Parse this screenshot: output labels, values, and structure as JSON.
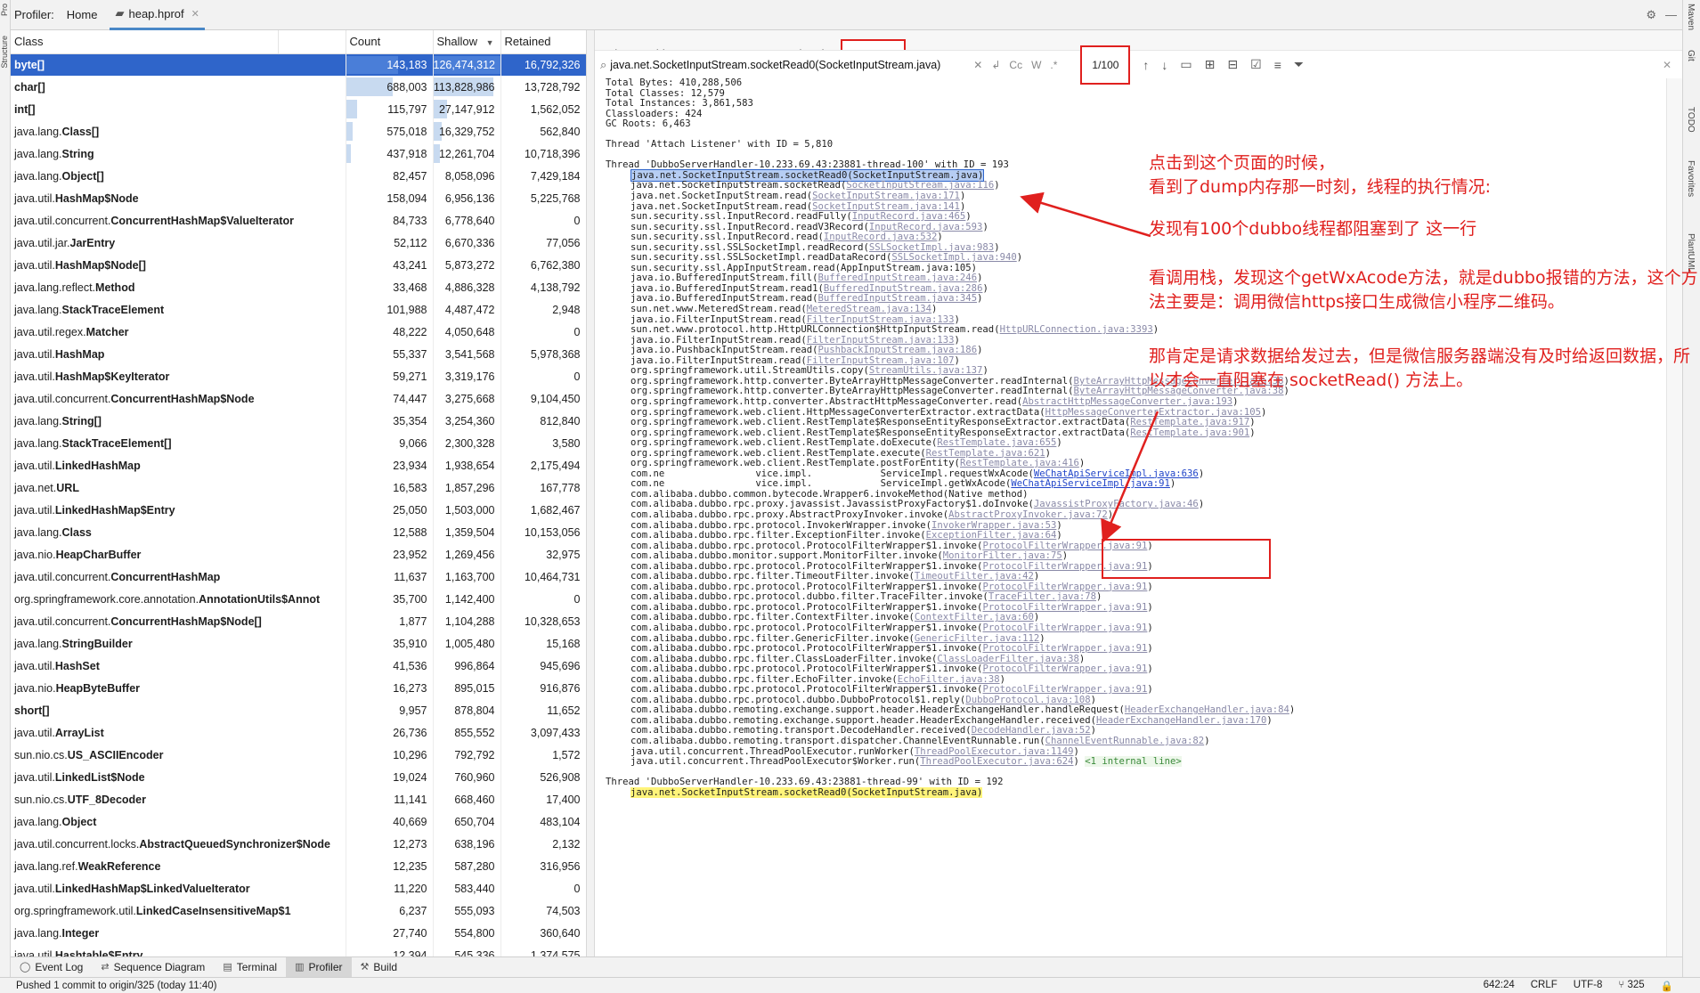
{
  "title_bar": {
    "crumbs": [
      "Profiler:",
      "Home"
    ],
    "file_tab": "heap.hprof"
  },
  "class_table": {
    "columns": [
      "Class",
      "Count",
      "Shallow",
      "Retained"
    ],
    "sort_indicator": "▼",
    "selected_row": 0,
    "rows": [
      {
        "pkg": "",
        "cls": "byte[]",
        "count": "143,183",
        "shallow": "126,474,312",
        "retained": "16,792,326",
        "bar": 1.0
      },
      {
        "pkg": "",
        "cls": "char[]",
        "count": "688,003",
        "shallow": "113,828,986",
        "retained": "13,728,792",
        "bar": 0.9
      },
      {
        "pkg": "",
        "cls": "int[]",
        "count": "115,797",
        "shallow": "27,147,912",
        "retained": "1,562,052",
        "bar": 0.21
      },
      {
        "pkg": "java.lang.",
        "cls": "Class[]",
        "count": "575,018",
        "shallow": "16,329,752",
        "retained": "562,840",
        "bar": 0.13
      },
      {
        "pkg": "java.lang.",
        "cls": "String",
        "count": "437,918",
        "shallow": "12,261,704",
        "retained": "10,718,396",
        "bar": 0.1
      },
      {
        "pkg": "java.lang.",
        "cls": "Object[]",
        "count": "82,457",
        "shallow": "8,058,096",
        "retained": "7,429,184",
        "bar": 0.0
      },
      {
        "pkg": "java.util.",
        "cls": "HashMap$Node",
        "count": "158,094",
        "shallow": "6,956,136",
        "retained": "5,225,768",
        "bar": 0.0
      },
      {
        "pkg": "java.util.concurrent.",
        "cls": "ConcurrentHashMap$ValueIterator",
        "count": "84,733",
        "shallow": "6,778,640",
        "retained": "0",
        "bar": 0.0
      },
      {
        "pkg": "java.util.jar.",
        "cls": "JarEntry",
        "count": "52,112",
        "shallow": "6,670,336",
        "retained": "77,056",
        "bar": 0.0
      },
      {
        "pkg": "java.util.",
        "cls": "HashMap$Node[]",
        "count": "43,241",
        "shallow": "5,873,272",
        "retained": "6,762,380",
        "bar": 0.0
      },
      {
        "pkg": "java.lang.reflect.",
        "cls": "Method",
        "count": "33,468",
        "shallow": "4,886,328",
        "retained": "4,138,792",
        "bar": 0.0
      },
      {
        "pkg": "java.lang.",
        "cls": "StackTraceElement",
        "count": "101,988",
        "shallow": "4,487,472",
        "retained": "2,948",
        "bar": 0.0
      },
      {
        "pkg": "java.util.regex.",
        "cls": "Matcher",
        "count": "48,222",
        "shallow": "4,050,648",
        "retained": "0",
        "bar": 0.0
      },
      {
        "pkg": "java.util.",
        "cls": "HashMap",
        "count": "55,337",
        "shallow": "3,541,568",
        "retained": "5,978,368",
        "bar": 0.0
      },
      {
        "pkg": "java.util.",
        "cls": "HashMap$KeyIterator",
        "count": "59,271",
        "shallow": "3,319,176",
        "retained": "0",
        "bar": 0.0
      },
      {
        "pkg": "java.util.concurrent.",
        "cls": "ConcurrentHashMap$Node",
        "count": "74,447",
        "shallow": "3,275,668",
        "retained": "9,104,450",
        "bar": 0.0
      },
      {
        "pkg": "java.lang.",
        "cls": "String[]",
        "count": "35,354",
        "shallow": "3,254,360",
        "retained": "812,840",
        "bar": 0.0
      },
      {
        "pkg": "java.lang.",
        "cls": "StackTraceElement[]",
        "count": "9,066",
        "shallow": "2,300,328",
        "retained": "3,580",
        "bar": 0.0
      },
      {
        "pkg": "java.util.",
        "cls": "LinkedHashMap",
        "count": "23,934",
        "shallow": "1,938,654",
        "retained": "2,175,494",
        "bar": 0.0
      },
      {
        "pkg": "java.net.",
        "cls": "URL",
        "count": "16,583",
        "shallow": "1,857,296",
        "retained": "167,778",
        "bar": 0.0
      },
      {
        "pkg": "java.util.",
        "cls": "LinkedHashMap$Entry",
        "count": "25,050",
        "shallow": "1,503,000",
        "retained": "1,682,467",
        "bar": 0.0
      },
      {
        "pkg": "java.lang.",
        "cls": "Class",
        "count": "12,588",
        "shallow": "1,359,504",
        "retained": "10,153,056",
        "bar": 0.0
      },
      {
        "pkg": "java.nio.",
        "cls": "HeapCharBuffer",
        "count": "23,952",
        "shallow": "1,269,456",
        "retained": "32,975",
        "bar": 0.0
      },
      {
        "pkg": "java.util.concurrent.",
        "cls": "ConcurrentHashMap",
        "count": "11,637",
        "shallow": "1,163,700",
        "retained": "10,464,731",
        "bar": 0.0
      },
      {
        "pkg": "org.springframework.core.annotation.",
        "cls": "AnnotationUtils$Annot",
        "count": "35,700",
        "shallow": "1,142,400",
        "retained": "0",
        "bar": 0.0
      },
      {
        "pkg": "java.util.concurrent.",
        "cls": "ConcurrentHashMap$Node[]",
        "count": "1,877",
        "shallow": "1,104,288",
        "retained": "10,328,653",
        "bar": 0.0
      },
      {
        "pkg": "java.lang.",
        "cls": "StringBuilder",
        "count": "35,910",
        "shallow": "1,005,480",
        "retained": "15,168",
        "bar": 0.0
      },
      {
        "pkg": "java.util.",
        "cls": "HashSet",
        "count": "41,536",
        "shallow": "996,864",
        "retained": "945,696",
        "bar": 0.0
      },
      {
        "pkg": "java.nio.",
        "cls": "HeapByteBuffer",
        "count": "16,273",
        "shallow": "895,015",
        "retained": "916,876",
        "bar": 0.0
      },
      {
        "pkg": "",
        "cls": "short[]",
        "count": "9,957",
        "shallow": "878,804",
        "retained": "11,652",
        "bar": 0.0
      },
      {
        "pkg": "java.util.",
        "cls": "ArrayList",
        "count": "26,736",
        "shallow": "855,552",
        "retained": "3,097,433",
        "bar": 0.0
      },
      {
        "pkg": "sun.nio.cs.",
        "cls": "US_ASCIIEncoder",
        "count": "10,296",
        "shallow": "792,792",
        "retained": "1,572",
        "bar": 0.0
      },
      {
        "pkg": "java.util.",
        "cls": "LinkedList$Node",
        "count": "19,024",
        "shallow": "760,960",
        "retained": "526,908",
        "bar": 0.0
      },
      {
        "pkg": "sun.nio.cs.",
        "cls": "UTF_8Decoder",
        "count": "11,141",
        "shallow": "668,460",
        "retained": "17,400",
        "bar": 0.0
      },
      {
        "pkg": "java.lang.",
        "cls": "Object",
        "count": "40,669",
        "shallow": "650,704",
        "retained": "483,104",
        "bar": 0.0
      },
      {
        "pkg": "java.util.concurrent.locks.",
        "cls": "AbstractQueuedSynchronizer$Node",
        "count": "12,273",
        "shallow": "638,196",
        "retained": "2,132",
        "bar": 0.0
      },
      {
        "pkg": "java.lang.ref.",
        "cls": "WeakReference",
        "count": "12,235",
        "shallow": "587,280",
        "retained": "316,956",
        "bar": 0.0
      },
      {
        "pkg": "java.util.",
        "cls": "LinkedHashMap$LinkedValueIterator",
        "count": "11,220",
        "shallow": "583,440",
        "retained": "0",
        "bar": 0.0
      },
      {
        "pkg": "org.springframework.util.",
        "cls": "LinkedCaseInsensitiveMap$1",
        "count": "6,237",
        "shallow": "555,093",
        "retained": "74,503",
        "bar": 0.0
      },
      {
        "pkg": "java.lang.",
        "cls": "Integer",
        "count": "27,740",
        "shallow": "554,800",
        "retained": "360,640",
        "bar": 0.0
      },
      {
        "pkg": "java.util.",
        "cls": "Hashtable$Entry",
        "count": "12,394",
        "shallow": "545,336",
        "retained": "1,374,575",
        "bar": 0.0
      }
    ]
  },
  "detail_tabs": {
    "items": [
      "Biggest Objects",
      "GC Roots",
      "Merged Paths",
      "Summary"
    ],
    "active": 3
  },
  "search": {
    "value": "java.net.SocketInputStream.socketRead0(SocketInputStream.java)",
    "opt_cc": "Cc",
    "opt_w": "W",
    "opt_regex": ".*",
    "match_count": "1/100"
  },
  "summary": {
    "header_lines": [
      "Total Bytes: 410,288,506",
      "Total Classes: 12,579",
      "Total Instances: 3,861,583",
      "Classloaders: 424",
      "GC Roots: 6,463",
      "",
      "Thread 'Attach Listener' with ID = 5,810",
      "",
      "Thread 'DubboServerHandler-10.233.69.43:23881-thread-100' with ID = 193"
    ],
    "stack": [
      {
        "text": "java.net.SocketInputStream.socketRead0(SocketInputStream.java)",
        "link": "",
        "style": "hlsel"
      },
      {
        "text": "java.net.SocketInputStream.socketRead(",
        "link": "SocketInputStream.java:116",
        "style": ""
      },
      {
        "text": "java.net.SocketInputStream.read(",
        "link": "SocketInputStream.java:171",
        "style": ""
      },
      {
        "text": "java.net.SocketInputStream.read(",
        "link": "SocketInputStream.java:141",
        "style": ""
      },
      {
        "text": "sun.security.ssl.InputRecord.readFully(",
        "link": "InputRecord.java:465",
        "style": ""
      },
      {
        "text": "sun.security.ssl.InputRecord.readV3Record(",
        "link": "InputRecord.java:593",
        "style": ""
      },
      {
        "text": "sun.security.ssl.InputRecord.read(",
        "link": "InputRecord.java:532",
        "style": ""
      },
      {
        "text": "sun.security.ssl.SSLSocketImpl.readRecord(",
        "link": "SSLSocketImpl.java:983",
        "style": ""
      },
      {
        "text": "sun.security.ssl.SSLSocketImpl.readDataRecord(",
        "link": "SSLSocketImpl.java:940",
        "style": ""
      },
      {
        "text": "sun.security.ssl.AppInputStream.read(AppInputStream.java:105)",
        "link": "",
        "style": ""
      },
      {
        "text": "java.io.BufferedInputStream.fill(",
        "link": "BufferedInputStream.java:246",
        "style": ""
      },
      {
        "text": "java.io.BufferedInputStream.read1(",
        "link": "BufferedInputStream.java:286",
        "style": ""
      },
      {
        "text": "java.io.BufferedInputStream.read(",
        "link": "BufferedInputStream.java:345",
        "style": ""
      },
      {
        "text": "sun.net.www.MeteredStream.read(",
        "link": "MeteredStream.java:134",
        "style": ""
      },
      {
        "text": "java.io.FilterInputStream.read(",
        "link": "FilterInputStream.java:133",
        "style": ""
      },
      {
        "text": "sun.net.www.protocol.http.HttpURLConnection$HttpInputStream.read(",
        "link": "HttpURLConnection.java:3393",
        "style": ""
      },
      {
        "text": "java.io.FilterInputStream.read(",
        "link": "FilterInputStream.java:133",
        "style": ""
      },
      {
        "text": "java.io.PushbackInputStream.read(",
        "link": "PushbackInputStream.java:186",
        "style": ""
      },
      {
        "text": "java.io.FilterInputStream.read(",
        "link": "FilterInputStream.java:107",
        "style": ""
      },
      {
        "text": "org.springframework.util.StreamUtils.copy(",
        "link": "StreamUtils.java:137",
        "style": ""
      },
      {
        "text": "org.springframework.http.converter.ByteArrayHttpMessageConverter.readInternal(",
        "link": "ByteArrayHttpMessageConverter.java:38",
        "style": ""
      },
      {
        "text": "org.springframework.http.converter.ByteArrayHttpMessageConverter.readInternal(",
        "link": "ByteArrayHttpMessageConverter.java:38",
        "style": ""
      },
      {
        "text": "org.springframework.http.converter.AbstractHttpMessageConverter.read(",
        "link": "AbstractHttpMessageConverter.java:193",
        "style": ""
      },
      {
        "text": "org.springframework.web.client.HttpMessageConverterExtractor.extractData(",
        "link": "HttpMessageConverterExtractor.java:105",
        "style": ""
      },
      {
        "text": "org.springframework.web.client.RestTemplate$ResponseEntityResponseExtractor.extractData(",
        "link": "RestTemplate.java:917",
        "style": ""
      },
      {
        "text": "org.springframework.web.client.RestTemplate$ResponseEntityResponseExtractor.extractData(",
        "link": "RestTemplate.java:901",
        "style": ""
      },
      {
        "text": "org.springframework.web.client.RestTemplate.doExecute(",
        "link": "RestTemplate.java:655",
        "style": ""
      },
      {
        "text": "org.springframework.web.client.RestTemplate.execute(",
        "link": "RestTemplate.java:621",
        "style": ""
      },
      {
        "text": "org.springframework.web.client.RestTemplate.postForEntity(",
        "link": "RestTemplate.java:416",
        "style": ""
      },
      {
        "text": "com.ne                vice.impl.            ServiceImpl.requestWxAcode(",
        "link": "WeChatApiServiceImpl.java:636",
        "style": "blue"
      },
      {
        "text": "com.ne                vice.impl.            ServiceImpl.getWxAcode(",
        "link": "WeChatApiServiceImpl.java:91",
        "style": "blue"
      },
      {
        "text": "com.alibaba.dubbo.common.bytecode.Wrapper6.invokeMethod(Native method)",
        "link": "",
        "style": ""
      },
      {
        "text": "com.alibaba.dubbo.rpc.proxy.javassist.JavassistProxyFactory$1.doInvoke(",
        "link": "JavassistProxyFactory.java:46",
        "style": ""
      },
      {
        "text": "com.alibaba.dubbo.rpc.proxy.AbstractProxyInvoker.invoke(",
        "link": "AbstractProxyInvoker.java:72",
        "style": ""
      },
      {
        "text": "com.alibaba.dubbo.rpc.protocol.InvokerWrapper.invoke(",
        "link": "InvokerWrapper.java:53",
        "style": ""
      },
      {
        "text": "com.alibaba.dubbo.rpc.filter.ExceptionFilter.invoke(",
        "link": "ExceptionFilter.java:64",
        "style": ""
      },
      {
        "text": "com.alibaba.dubbo.rpc.protocol.ProtocolFilterWrapper$1.invoke(",
        "link": "ProtocolFilterWrapper.java:91",
        "style": ""
      },
      {
        "text": "com.alibaba.dubbo.monitor.support.MonitorFilter.invoke(",
        "link": "MonitorFilter.java:75",
        "style": ""
      },
      {
        "text": "com.alibaba.dubbo.rpc.protocol.ProtocolFilterWrapper$1.invoke(",
        "link": "ProtocolFilterWrapper.java:91",
        "style": ""
      },
      {
        "text": "com.alibaba.dubbo.rpc.filter.TimeoutFilter.invoke(",
        "link": "TimeoutFilter.java:42",
        "style": ""
      },
      {
        "text": "com.alibaba.dubbo.rpc.protocol.ProtocolFilterWrapper$1.invoke(",
        "link": "ProtocolFilterWrapper.java:91",
        "style": ""
      },
      {
        "text": "com.alibaba.dubbo.rpc.protocol.dubbo.filter.TraceFilter.invoke(",
        "link": "TraceFilter.java:78",
        "style": ""
      },
      {
        "text": "com.alibaba.dubbo.rpc.protocol.ProtocolFilterWrapper$1.invoke(",
        "link": "ProtocolFilterWrapper.java:91",
        "style": ""
      },
      {
        "text": "com.alibaba.dubbo.rpc.filter.ContextFilter.invoke(",
        "link": "ContextFilter.java:60",
        "style": ""
      },
      {
        "text": "com.alibaba.dubbo.rpc.protocol.ProtocolFilterWrapper$1.invoke(",
        "link": "ProtocolFilterWrapper.java:91",
        "style": ""
      },
      {
        "text": "com.alibaba.dubbo.rpc.filter.GenericFilter.invoke(",
        "link": "GenericFilter.java:112",
        "style": ""
      },
      {
        "text": "com.alibaba.dubbo.rpc.protocol.ProtocolFilterWrapper$1.invoke(",
        "link": "ProtocolFilterWrapper.java:91",
        "style": ""
      },
      {
        "text": "com.alibaba.dubbo.rpc.filter.ClassLoaderFilter.invoke(",
        "link": "ClassLoaderFilter.java:38",
        "style": ""
      },
      {
        "text": "com.alibaba.dubbo.rpc.protocol.ProtocolFilterWrapper$1.invoke(",
        "link": "ProtocolFilterWrapper.java:91",
        "style": ""
      },
      {
        "text": "com.alibaba.dubbo.rpc.filter.EchoFilter.invoke(",
        "link": "EchoFilter.java:38",
        "style": ""
      },
      {
        "text": "com.alibaba.dubbo.rpc.protocol.ProtocolFilterWrapper$1.invoke(",
        "link": "ProtocolFilterWrapper.java:91",
        "style": ""
      },
      {
        "text": "com.alibaba.dubbo.rpc.protocol.dubbo.DubboProtocol$1.reply(",
        "link": "DubboProtocol.java:108",
        "style": ""
      },
      {
        "text": "com.alibaba.dubbo.remoting.exchange.support.header.HeaderExchangeHandler.handleRequest(",
        "link": "HeaderExchangeHandler.java:84",
        "style": ""
      },
      {
        "text": "com.alibaba.dubbo.remoting.exchange.support.header.HeaderExchangeHandler.received(",
        "link": "HeaderExchangeHandler.java:170",
        "style": ""
      },
      {
        "text": "com.alibaba.dubbo.remoting.transport.DecodeHandler.received(",
        "link": "DecodeHandler.java:52",
        "style": ""
      },
      {
        "text": "com.alibaba.dubbo.remoting.transport.dispatcher.ChannelEventRunnable.run(",
        "link": "ChannelEventRunnable.java:82",
        "style": ""
      },
      {
        "text": "java.util.concurrent.ThreadPoolExecutor.runWorker(",
        "link": "ThreadPoolExecutor.java:1149",
        "style": ""
      },
      {
        "text": "java.util.concurrent.ThreadPoolExecutor$Worker.run(",
        "link": "ThreadPoolExecutor.java:624",
        "style": "internal"
      }
    ],
    "internal_line": "<1 internal line>",
    "next_thread": "Thread 'DubboServerHandler-10.233.69.43:23881-thread-99' with ID = 192",
    "next_thread_first": "java.net.SocketInputStream.socketRead0(SocketInputStream.java)"
  },
  "annotations": {
    "note1_line1": "点击到这个页面的时候，",
    "note1_line2": "看到了dump内存那一时刻，线程的执行情况:",
    "note2": "发现有100个dubbo线程都阻塞到了 这一行",
    "note3": "看调用栈，发现这个getWxAcode方法，就是dubbo报错的方法，这个方法主要是：调用微信https接口生成微信小程序二维码。",
    "note4": "那肯定是请求数据给发过去，但是微信服务器端没有及时给返回数据，所以才会一直阻塞在 socketRead() 方法上。",
    "color": "#e0201e"
  },
  "left_strip": {
    "labels": [
      "Pro",
      "Structure"
    ]
  },
  "right_strip": {
    "labels": [
      "Maven",
      "Git",
      "TODO",
      "Favorites",
      "PlantUML"
    ]
  },
  "tool_tabs": {
    "items": [
      {
        "label": "Event Log",
        "icon": "event-log-icon"
      },
      {
        "label": "Sequence Diagram",
        "icon": "sequence-diagram-icon"
      },
      {
        "label": "Terminal",
        "icon": "terminal-icon"
      },
      {
        "label": "Profiler",
        "icon": "profiler-icon"
      },
      {
        "label": "Build",
        "icon": "build-icon"
      }
    ],
    "active": 3
  },
  "status_bar": {
    "message": "Pushed 1 commit to origin/325 (today 11:40)",
    "position": "642:24",
    "line_sep": "CRLF",
    "encoding": "UTF-8",
    "branch": "325"
  }
}
